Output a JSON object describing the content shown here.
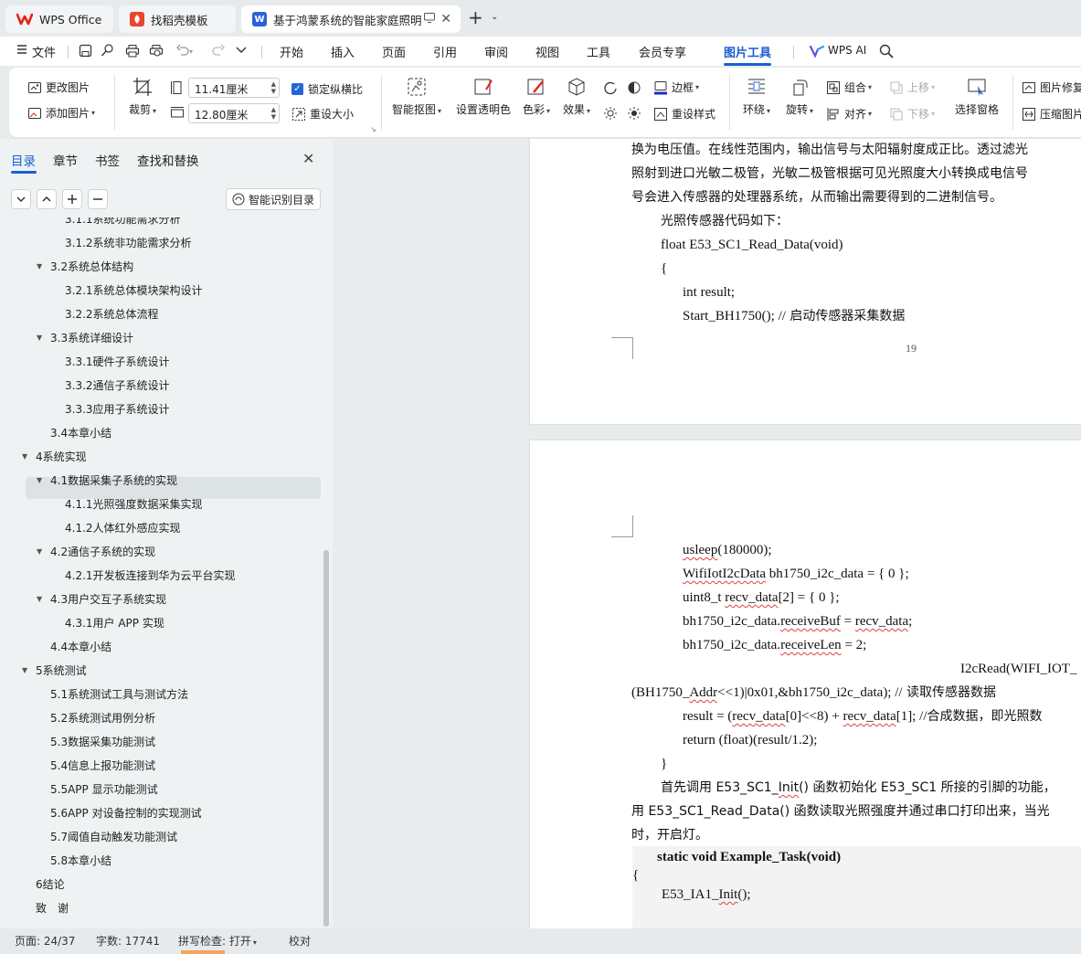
{
  "tabs": [
    {
      "label": "WPS Office"
    },
    {
      "label": "找稻壳模板"
    },
    {
      "label": "基于鸿蒙系统的智能家庭照明"
    }
  ],
  "menubar": {
    "file": "文件",
    "items": [
      "开始",
      "插入",
      "页面",
      "引用",
      "审阅",
      "视图",
      "工具",
      "会员专享",
      "图片工具"
    ],
    "wps_ai": "WPS AI"
  },
  "ribbon": {
    "change_picture": "更改图片",
    "add_picture": "添加图片",
    "crop": "裁剪",
    "width_value": "11.41厘米",
    "height_value": "12.80厘米",
    "lock_ratio": "锁定纵横比",
    "reset_size": "重设大小",
    "smart_cutout": "智能抠图",
    "set_transparent": "设置透明色",
    "color": "色彩",
    "effect": "效果",
    "border": "边框",
    "reset_style": "重设样式",
    "wrap": "环绕",
    "rotate": "旋转",
    "group": "组合",
    "align": "对齐",
    "bring_forward": "上移",
    "send_backward": "下移",
    "selection_pane": "选择窗格",
    "picture_repair": "图片修复",
    "compress_picture": "压缩图片"
  },
  "nav": {
    "tabs": [
      "目录",
      "章节",
      "书签",
      "查找和替换"
    ],
    "smart_toc": "智能识别目录",
    "toc": [
      {
        "label": "3.1.1系统功能需求分析",
        "level": 3
      },
      {
        "label": "3.1.2系统非功能需求分析",
        "level": 3
      },
      {
        "label": "3.2系统总体结构",
        "level": 2,
        "expanded": true
      },
      {
        "label": "3.2.1系统总体模块架构设计",
        "level": 3
      },
      {
        "label": "3.2.2系统总体流程",
        "level": 3
      },
      {
        "label": "3.3系统详细设计",
        "level": 2,
        "expanded": true
      },
      {
        "label": "3.3.1硬件子系统设计",
        "level": 3
      },
      {
        "label": "3.3.2通信子系统设计",
        "level": 3
      },
      {
        "label": "3.3.3应用子系统设计",
        "level": 3
      },
      {
        "label": "3.4本章小结",
        "level": 2
      },
      {
        "label": "4系统实现",
        "level": 1,
        "expanded": true
      },
      {
        "label": "4.1数据采集子系统的实现",
        "level": 2,
        "expanded": true,
        "active": true
      },
      {
        "label": "4.1.1光照强度数据采集实现",
        "level": 3
      },
      {
        "label": "4.1.2人体红外感应实现",
        "level": 3
      },
      {
        "label": "4.2通信子系统的实现",
        "level": 2,
        "expanded": true
      },
      {
        "label": "4.2.1开发板连接到华为云平台实现",
        "level": 3
      },
      {
        "label": "4.3用户交互子系统实现",
        "level": 2,
        "expanded": true
      },
      {
        "label": "4.3.1用户 APP 实现",
        "level": 3
      },
      {
        "label": "4.4本章小结",
        "level": 2
      },
      {
        "label": "5系统测试",
        "level": 1,
        "expanded": true
      },
      {
        "label": "5.1系统测试工具与测试方法",
        "level": 2
      },
      {
        "label": "5.2系统测试用例分析",
        "level": 2
      },
      {
        "label": "5.3数据采集功能测试",
        "level": 2
      },
      {
        "label": "5.4信息上报功能测试",
        "level": 2
      },
      {
        "label": "5.5APP 显示功能测试",
        "level": 2
      },
      {
        "label": "5.6APP 对设备控制的实现测试",
        "level": 2
      },
      {
        "label": "5.7阈值自动触发功能测试",
        "level": 2
      },
      {
        "label": "5.8本章小结",
        "level": 2
      },
      {
        "label": "6结论",
        "level": 1
      },
      {
        "label": "致　谢",
        "level": 1
      }
    ]
  },
  "doc": {
    "page1": {
      "lines": [
        "换为电压值。在线性范围内，输出信号与太阳辐射度成正比。透过滤光",
        "照射到进口光敏二极管，光敏二极管根据可见光照度大小转换成电信号",
        "号会进入传感器的处理器系统，从而输出需要得到的二进制信号。",
        "光照传感器代码如下：",
        "float E53_SC1_Read_Data(void)",
        "{",
        "int result;"
      ],
      "start_prefix": "Start_BH1750(); //",
      "start_comment": "启动传感器采集数据",
      "page_number": "19"
    },
    "page2": {
      "usleep_fn": "usleep",
      "usleep_args": "(180000);",
      "wifi_type": "WifiIotI2cData",
      "wifi_rest": " bh1750_i2c_data = { 0 };",
      "uint_pre": "uint8_t ",
      "recv_data": "recv_data",
      "uint_post": "[2] = { 0 };",
      "bh_pre": "bh1750_i2c_data.",
      "receive_buf": "receiveBuf",
      "eq": " = ",
      "recv_end": ";",
      "receive_len": "receiveLen",
      "len_post": " = 2;",
      "i2c_read": "I2cRead(WIFI_IOT_",
      "bh_addr_pre": "(BH1750_",
      "bh_addr": "Addr",
      "bh_addr_post": "<<1)|0x01,&bh1750_i2c_data);",
      "bh_addr_comment_slash": "//",
      "bh_addr_comment": "读取传感器数据",
      "result_pre": "result = (",
      "result_mid": "[0]<<8) + ",
      "result_post": "[1];",
      "result_comment_slash": "//",
      "result_comment": "合成数据，即光照数",
      "return_line": "return (float)(result/1.2);",
      "close_brace": "}",
      "para1_pre": "首先调用 E53_SC1_",
      "para1_init": "Init",
      "para1_post": "() 函数初始化 E53_SC1 所接的引脚的功能，",
      "para2": "用 E53_SC1_Read_Data() 函数读取光照强度并通过串口打印出来，当光",
      "para3": "时，开启灯。",
      "code_title": "static void Example_Task(void)",
      "code_brace": "{",
      "code_call_pre": "E53_IA1_",
      "code_call_init": "Init",
      "code_call_post": "();"
    }
  },
  "status": {
    "page": "页面: 24/37",
    "words": "字数: 17741",
    "spell": "拼写检查: 打开",
    "proof": "校对"
  }
}
